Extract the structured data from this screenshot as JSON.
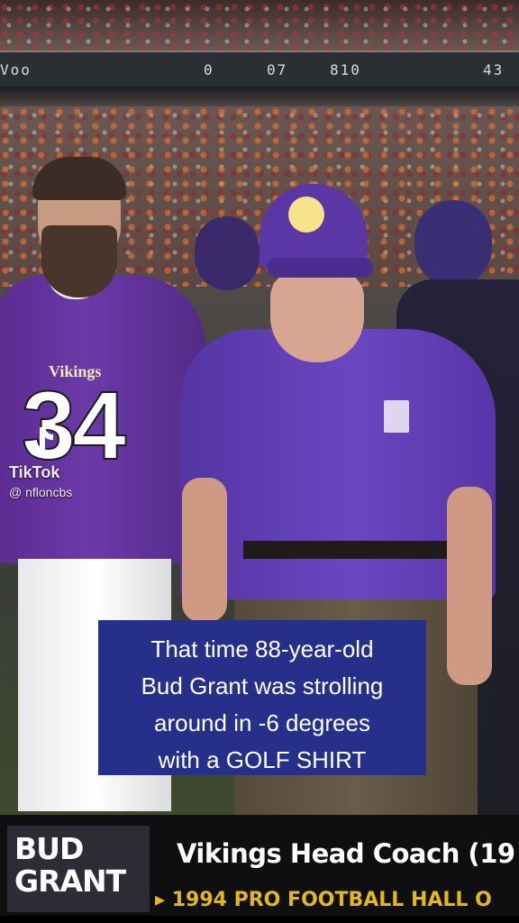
{
  "scoreboard": {
    "left_text": "Voo",
    "cells": [
      "0",
      "07",
      "810",
      "43"
    ]
  },
  "jersey": {
    "brand": "Vikings",
    "number": "34"
  },
  "watermark": {
    "brand": "TikTok",
    "handle": "@ nfloncbs"
  },
  "caption": {
    "lines": [
      "That time 88-year-old",
      "Bud Grant was strolling",
      "around in -6 degrees",
      "with a GOLF SHIRT"
    ]
  },
  "lower_third": {
    "first_name": "BUD",
    "last_name": "GRANT",
    "title": "Vikings Head Coach (19",
    "subtitle": "1994 PRO FOOTBALL HALL O"
  },
  "colors": {
    "caption_bg": "#262f8a",
    "jersey_purple": "#5a2b8f",
    "lower_third_bg": "#0f0f12",
    "subtitle_gold": "#e3b81f"
  }
}
